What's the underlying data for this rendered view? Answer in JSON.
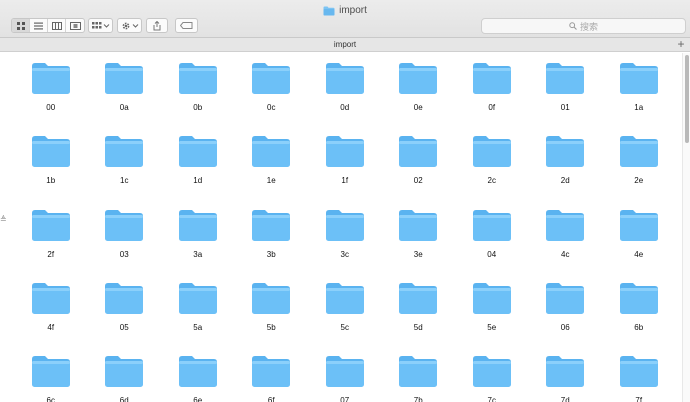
{
  "window": {
    "title": "import"
  },
  "toolbar": {
    "views": [
      {
        "icon": "icon-view-icon",
        "active": true
      },
      {
        "icon": "list-view-icon",
        "active": false
      },
      {
        "icon": "column-view-icon",
        "active": false
      },
      {
        "icon": "gallery-view-icon",
        "active": false
      }
    ],
    "arrange_icon": "arrange-icon",
    "action_icon": "gear-icon",
    "share_icon": "share-icon",
    "tag_icon": "tag-icon"
  },
  "search": {
    "placeholder": "搜索"
  },
  "pathbar": {
    "title": "import"
  },
  "colors": {
    "folder_top": "#8bd0fb",
    "folder_body": "#6cc0f7",
    "folder_tab": "#5ab3f0"
  },
  "folders": [
    "00",
    "0a",
    "0b",
    "0c",
    "0d",
    "0e",
    "0f",
    "01",
    "1a",
    "1b",
    "1c",
    "1d",
    "1e",
    "1f",
    "02",
    "2c",
    "2d",
    "2e",
    "2f",
    "03",
    "3a",
    "3b",
    "3c",
    "3e",
    "04",
    "4c",
    "4e",
    "4f",
    "05",
    "5a",
    "5b",
    "5c",
    "5d",
    "5e",
    "06",
    "6b",
    "6c",
    "6d",
    "6e",
    "6f",
    "07",
    "7b",
    "7c",
    "7d",
    "7f"
  ]
}
